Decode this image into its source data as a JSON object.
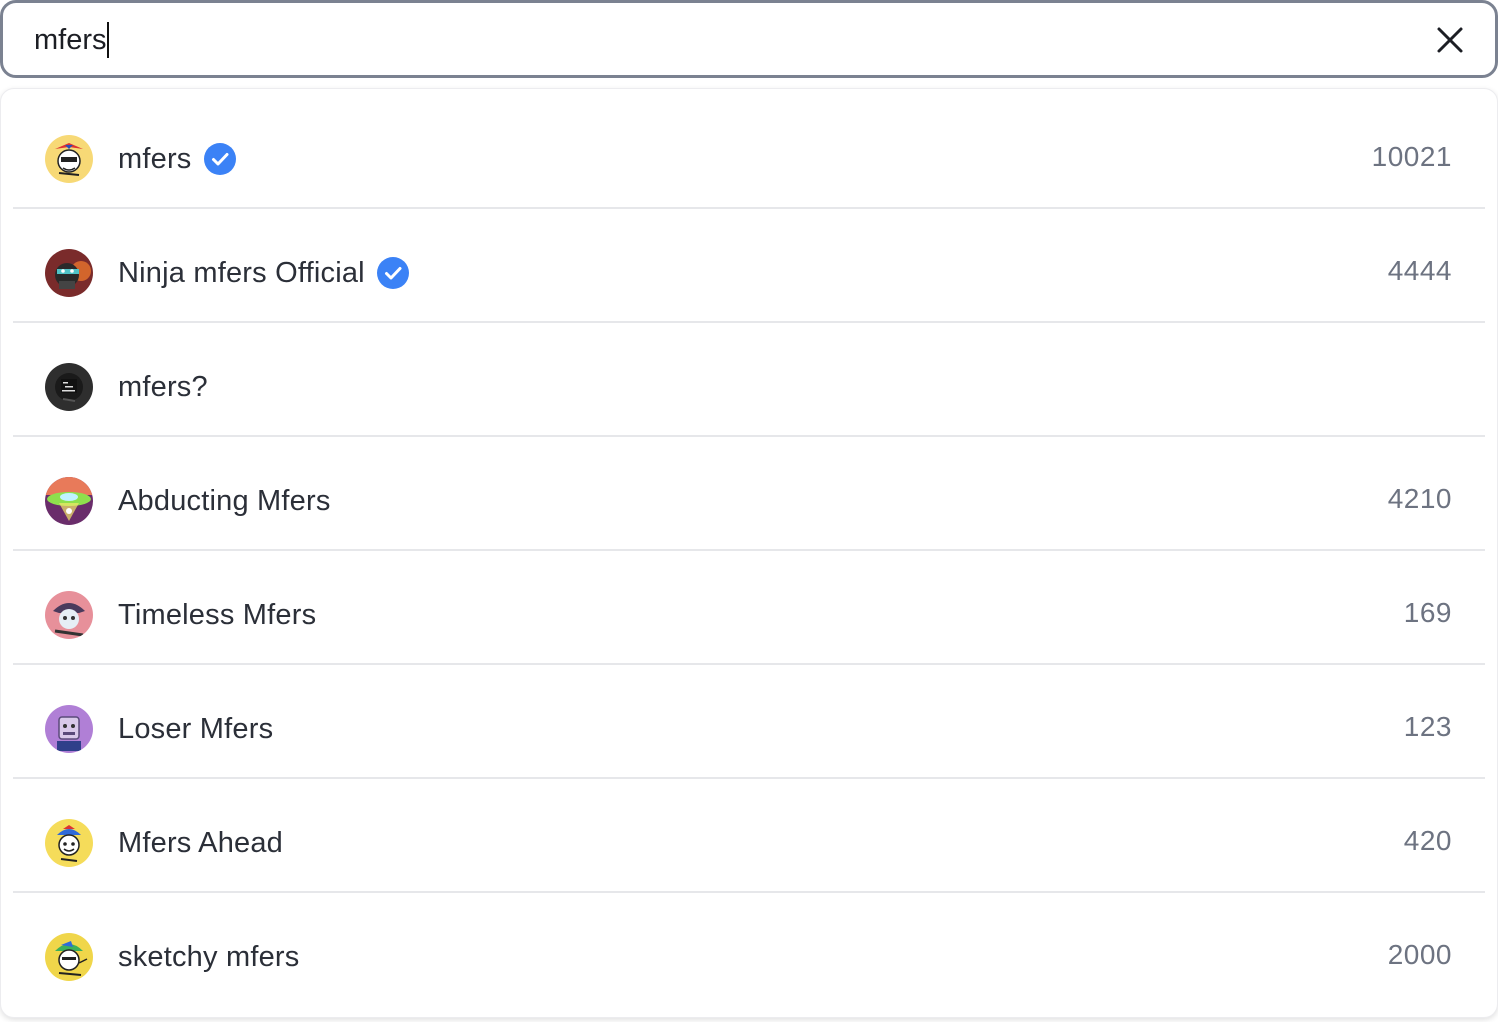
{
  "search": {
    "value": "mfers",
    "clear_icon": "close-icon"
  },
  "results": [
    {
      "name": "mfers",
      "verified": true,
      "count": "10021",
      "avatar": "mfers-avatar-icon"
    },
    {
      "name": "Ninja mfers Official",
      "verified": true,
      "count": "4444",
      "avatar": "ninja-mfers-avatar-icon"
    },
    {
      "name": "mfers?",
      "verified": false,
      "count": "",
      "avatar": "mfers-question-avatar-icon"
    },
    {
      "name": "Abducting Mfers",
      "verified": false,
      "count": "4210",
      "avatar": "abducting-mfers-avatar-icon"
    },
    {
      "name": "Timeless Mfers",
      "verified": false,
      "count": "169",
      "avatar": "timeless-mfers-avatar-icon"
    },
    {
      "name": "Loser Mfers",
      "verified": false,
      "count": "123",
      "avatar": "loser-mfers-avatar-icon"
    },
    {
      "name": "Mfers Ahead",
      "verified": false,
      "count": "420",
      "avatar": "mfers-ahead-avatar-icon"
    },
    {
      "name": "sketchy mfers",
      "verified": false,
      "count": "2000",
      "avatar": "sketchy-mfers-avatar-icon"
    }
  ],
  "colors": {
    "verified_badge": "#3b82f6",
    "text_primary": "#2b2f38",
    "text_count": "#6d7381",
    "divider": "#e6e7ea",
    "search_border": "#7b8291"
  }
}
